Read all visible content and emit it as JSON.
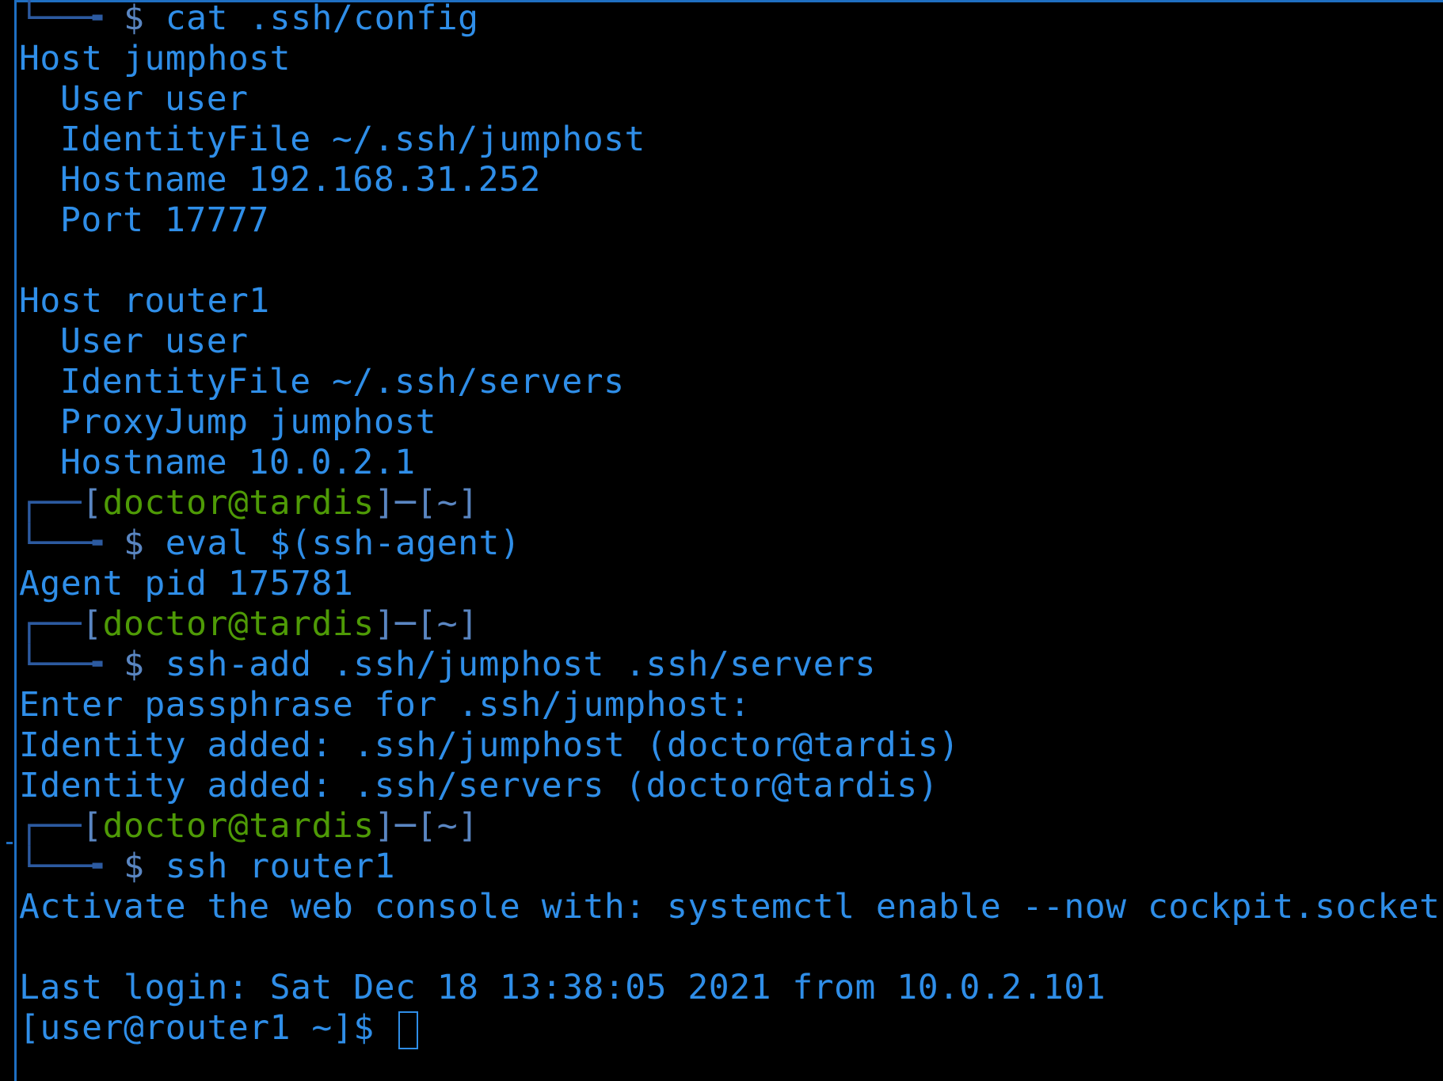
{
  "prompt": {
    "user_host": "doctor@tardis",
    "dir": "~",
    "symbol": "$"
  },
  "lines": {
    "cmd_cat": "cat .ssh/config",
    "cfg_host1": "Host jumphost",
    "cfg_user1": "User user",
    "cfg_identity1": "IdentityFile ~/.ssh/jumphost",
    "cfg_hostname1": "Hostname 192.168.31.252",
    "cfg_port1": "Port 17777",
    "cfg_host2": "Host router1",
    "cfg_user2": "User user",
    "cfg_identity2": "IdentityFile ~/.ssh/servers",
    "cfg_proxy2": "ProxyJump jumphost",
    "cfg_hostname2": "Hostname 10.0.2.1",
    "cmd_eval": "eval $(ssh-agent)",
    "out_agent": "Agent pid 175781",
    "cmd_sshadd": "ssh-add .ssh/jumphost .ssh/servers",
    "out_passphrase": "Enter passphrase for .ssh/jumphost:",
    "out_identity1": "Identity added: .ssh/jumphost (doctor@tardis)",
    "out_identity2": "Identity added: .ssh/servers (doctor@tardis)",
    "cmd_ssh": "ssh router1",
    "out_cockpit": "Activate the web console with: systemctl enable --now cockpit.socket",
    "out_lastlogin": "Last login: Sat Dec 18 13:38:05 2021 from 10.0.2.101",
    "remote_prompt": "[user@router1 ~]$ "
  },
  "colors": {
    "background": "#000000",
    "text": "#2f8ee8",
    "user_host": "#4e9a06",
    "frame": "#2c5aa0"
  }
}
